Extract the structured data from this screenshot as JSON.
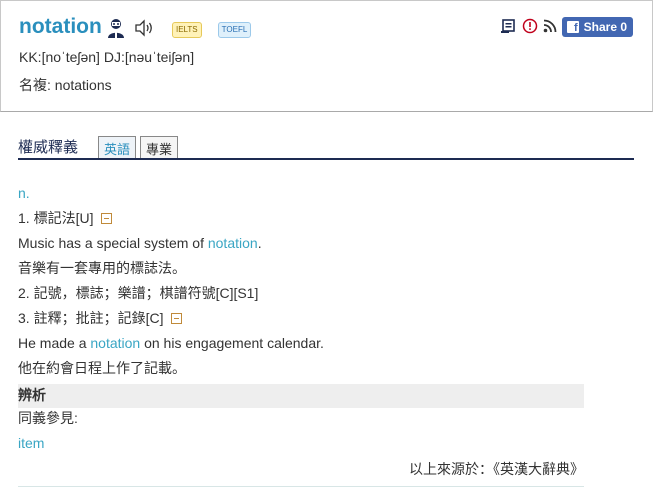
{
  "header": {
    "word": "notation",
    "tag_ielts": "IELTS",
    "tag_toefl": "TOEFL",
    "pronunciation": "KK:[noˈteʃən] DJ:[nəuˈteiʃən]",
    "plural": "名複: notations",
    "share_label": "Share 0"
  },
  "tabs": {
    "title": "權威釋義",
    "items": [
      {
        "label": "英語",
        "active": true
      },
      {
        "label": "專業",
        "active": false
      }
    ]
  },
  "entry": {
    "pos": "n.",
    "sense1": "1. 標記法[U]",
    "ex1_before": "Music has a special system of ",
    "ex1_hl": "notation",
    "ex1_after": ".",
    "ex1_zh": "音樂有一套專用的標誌法。",
    "sense2": "2. 記號，標誌；樂譜；棋譜符號[C][S1]",
    "sense3": "3. 註釋；批註；記錄[C]",
    "ex2_before": "He made a ",
    "ex2_hl": "notation",
    "ex2_after": " on his engagement calendar.",
    "ex2_zh": "他在約會日程上作了記載。",
    "section": "辨析",
    "synonym_label": "同義參見:",
    "synonym_link": "item",
    "source": "以上來源於：《英漢大辭典》"
  },
  "colors": {
    "word": "#2a8fbd",
    "link": "#3aa6c4",
    "tab_underline": "#1d2b52",
    "facebook": "#4267b2"
  },
  "icons": [
    "person-icon",
    "speaker-icon",
    "wordbook-icon",
    "report-icon",
    "rss-icon",
    "facebook-icon",
    "collapse-icon"
  ]
}
